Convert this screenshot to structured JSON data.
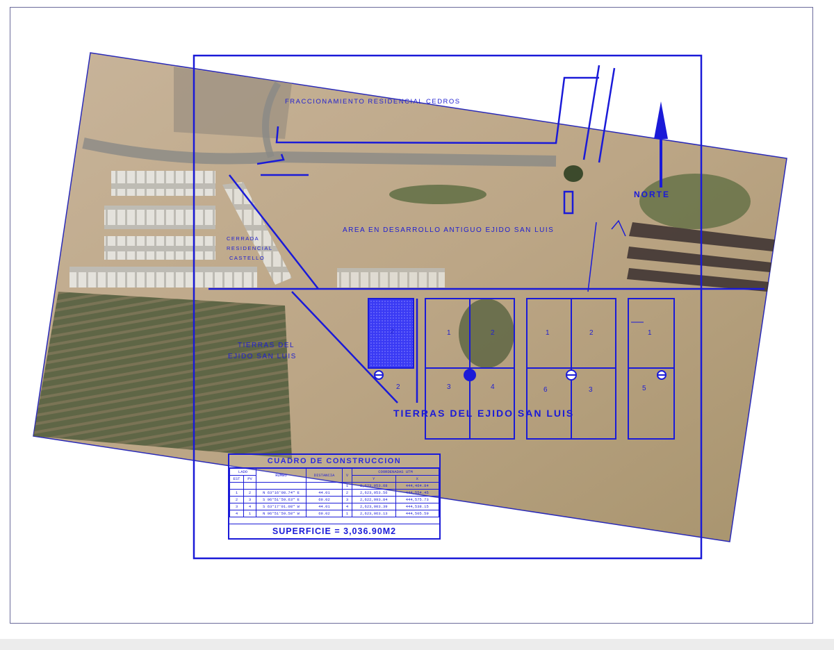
{
  "map": {
    "labels": {
      "fraccionamiento": "FRACCIONAMIENTO RESIDENCIAL CEDROS",
      "norte": "NORTE",
      "area": "AREA EN DESARROLLO ANTIGUO EJIDO SAN LUIS",
      "cerrada_1": "CERRADA",
      "cerrada_2": "RESIDENCIAL",
      "cerrada_3": "CASTELLO",
      "tierras_left_1": "TIERRAS DEL",
      "tierras_left_2": "EJIDO SAN LUIS",
      "tierras_main": "TIERRAS DEL EJIDO SAN LUIS"
    },
    "lots": {
      "selected": "2",
      "block1": [
        "1",
        "2",
        "3",
        "4"
      ],
      "block2": [
        "1",
        "2",
        "6",
        "3"
      ],
      "block3": [
        "1",
        "5"
      ],
      "corner": "2"
    },
    "colors": {
      "linework": "#1a1ad8",
      "selected_lot": "#2b2bf0",
      "terrain": "#b9a488"
    }
  },
  "cuadro": {
    "title": "CUADRO DE CONSTRUCCION",
    "headers": {
      "lado": "LADO",
      "est": "EST",
      "pv": "PV",
      "rumbo": "RUMBO",
      "distancia": "DISTANCIA",
      "v": "V",
      "coordenadas": "COORDENADAS UTM",
      "y": "Y",
      "x": "X"
    },
    "rows": [
      [
        "",
        "",
        "",
        "",
        "1",
        "2,623,053.68",
        "444,464.84"
      ],
      [
        "1",
        "2",
        "N 63°16'08.74\" E",
        "44.01",
        "2",
        "2,623,053.56",
        "444,554.45"
      ],
      [
        "2",
        "3",
        "S 06°51'59.63\" E",
        "69.02",
        "3",
        "2,622,993.84",
        "444,575.73"
      ],
      [
        "3",
        "4",
        "S 63°17'01.08\" W",
        "44.01",
        "4",
        "2,623,003.39",
        "444,538.15"
      ],
      [
        "4",
        "1",
        "N 06°51'59.58\" W",
        "69.02",
        "1",
        "2,623,063.13",
        "444,505.59"
      ]
    ],
    "superficie": "SUPERFICIE = 3,036.90M2"
  }
}
